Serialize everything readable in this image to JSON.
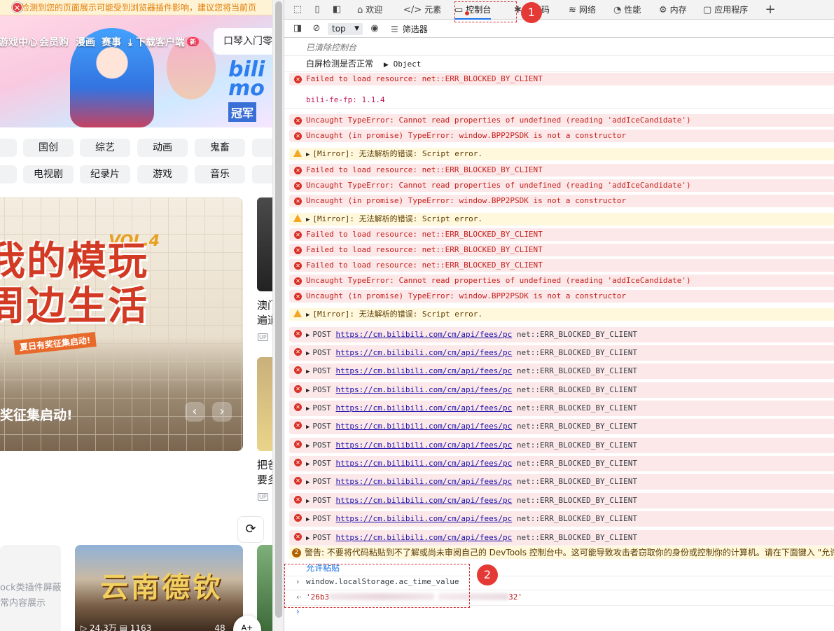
{
  "webpage": {
    "warning": "检测到您的页面展示可能受到浏览器插件影响，建议您将当前页",
    "nav": [
      "游戏中心",
      "会员购",
      "漫画",
      "赛事",
      "下载客户端"
    ],
    "nav_badge": "新",
    "search_placeholder": "口琴入门零",
    "banner_logo_1": "bili",
    "banner_logo_2": "mo",
    "banner_logo_3": "冠军",
    "categories_row1": [
      "国创",
      "综艺",
      "动画",
      "鬼畜"
    ],
    "categories_row2": [
      "电视剧",
      "纪录片",
      "游戏",
      "音乐"
    ],
    "hero_headline": "我的模玩\n周边生活",
    "hero_vol": "VOL.4",
    "hero_sub": "夏日有奖征集启动!",
    "hero_caption": "奖征集启动!",
    "side_text_1": "澳门",
    "side_text_2": "遍道",
    "side_text_3": "把爸",
    "side_text_4": "要多",
    "up_badge": "UP",
    "blocked_text_1": "ock类插件屏蔽",
    "blocked_text_2": "常内容展示",
    "yunnan_title": "云南德钦",
    "yunnan_views": "24.3万",
    "yunnan_comments": "1163",
    "yunnan_duration": "48",
    "float_label": "A+"
  },
  "devtools": {
    "tabs": [
      {
        "icon": "⌂",
        "label": "欢迎"
      },
      {
        "icon": "</>",
        "label": "元素"
      },
      {
        "icon": "▭",
        "label": "控制台"
      },
      {
        "icon": "✱",
        "label": "源代码"
      },
      {
        "icon": "≋",
        "label": "网络"
      },
      {
        "icon": "◔",
        "label": "性能"
      },
      {
        "icon": "⚙",
        "label": "内存"
      },
      {
        "icon": "▢",
        "label": "应用程序"
      }
    ],
    "add_tab": "+",
    "context": "top",
    "filter_label": "筛选器",
    "annotation_1": "1",
    "annotation_2": "2",
    "console": {
      "cleared": "已清除控制台",
      "white_screen": "白屏检测是否正常",
      "object": "Object",
      "blocked": "Failed to load resource: net::ERR_BLOCKED_BY_CLIENT",
      "version": "bili-fe-fp: 1.1.4",
      "ice": "Uncaught TypeError: Cannot read properties of undefined (reading 'addIceCandidate')",
      "bpp": "Uncaught (in promise) TypeError: window.BPP2PSDK is not a constructor",
      "mirror": "[Mirror]: 无法解析的错误: Script error.",
      "post_method": "POST",
      "post_url": "https://cm.bilibili.com/cm/api/fees/pc",
      "post_err": "net::ERR_BLOCKED_BY_CLIENT",
      "warn_count": "2",
      "paste_warning": "警告: 不要将代码粘贴到不了解或尚未审阅自己的 DevTools 控制台中。这可能导致攻击者窃取你的身份或控制你的计算机。请在下面键入 \"允许粘贴\"",
      "allow_paste": "允许粘贴",
      "input_cmd": "window.localStorage.ac_time_value",
      "output_prefix": "'26b3",
      "output_suffix": "32'"
    }
  }
}
